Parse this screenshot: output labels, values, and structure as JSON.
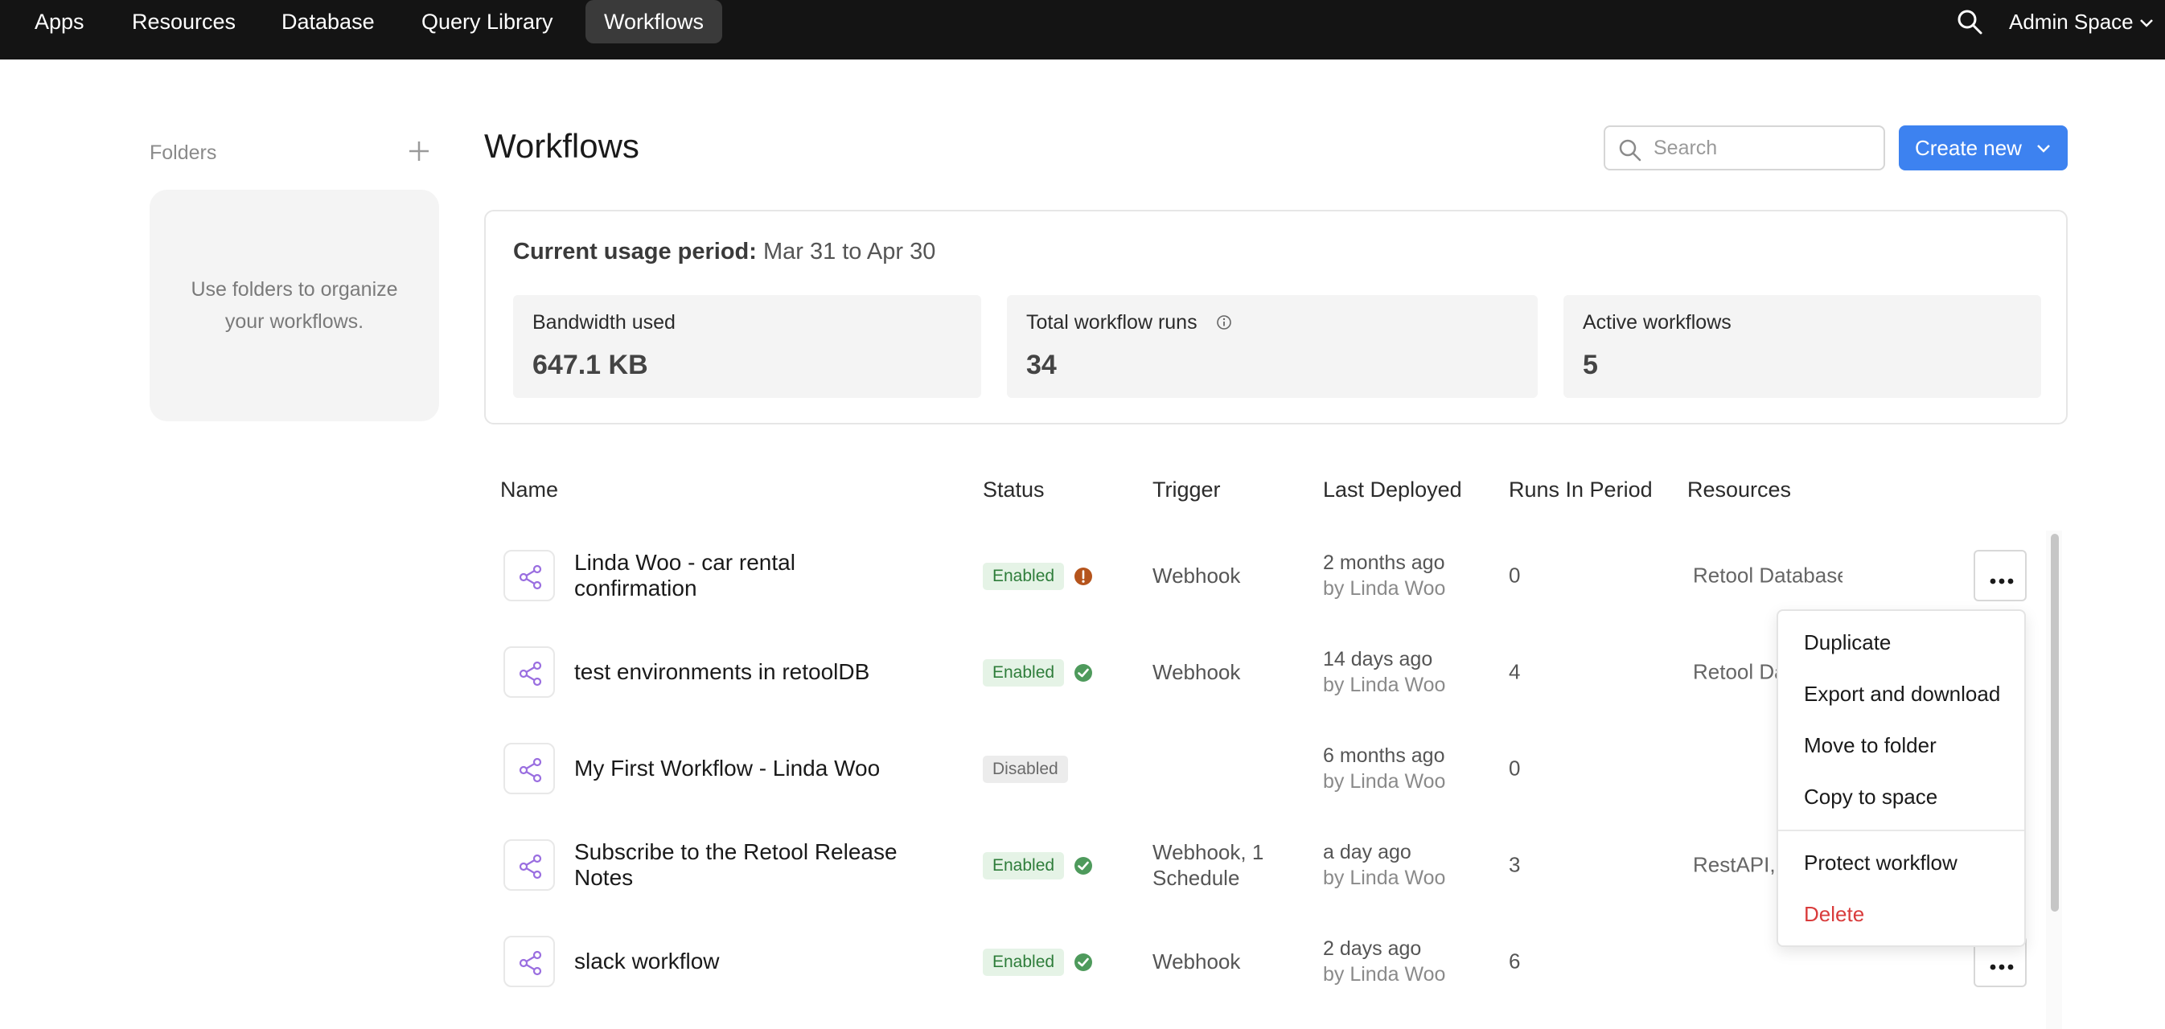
{
  "topnav": {
    "items": [
      {
        "label": "Apps"
      },
      {
        "label": "Resources"
      },
      {
        "label": "Database"
      },
      {
        "label": "Query Library"
      },
      {
        "label": "Workflows",
        "active": true
      }
    ],
    "space_label": "Admin Space",
    "search_icon": "search-icon"
  },
  "folders": {
    "label": "Folders",
    "empty_text": "Use folders to organize your workflows."
  },
  "header": {
    "title": "Workflows",
    "search_placeholder": "Search",
    "create_label": "Create new"
  },
  "usage": {
    "title": "Current usage period:",
    "period": "Mar 31 to Apr 30",
    "metrics": [
      {
        "label": "Bandwidth used",
        "value": "647.1 KB"
      },
      {
        "label": "Total workflow runs",
        "value": "34",
        "info_icon": true
      },
      {
        "label": "Active workflows",
        "value": "5"
      }
    ]
  },
  "table": {
    "columns": [
      "Name",
      "Status",
      "Trigger",
      "Last Deployed",
      "Runs In Period",
      "Resources"
    ],
    "rows": [
      {
        "name": "Linda Woo - car rental confirmation",
        "status": "Enabled",
        "status_icon": "warning",
        "trigger": "Webhook",
        "deployed": "2 months ago",
        "by": "by Linda Woo",
        "runs": "0",
        "resources": "Retool Database"
      },
      {
        "name": "test environments in retoolDB",
        "status": "Enabled",
        "status_icon": "check",
        "trigger": "Webhook",
        "deployed": "14 days ago",
        "by": "by Linda Woo",
        "runs": "4",
        "resources": "Retool Database"
      },
      {
        "name": "My First Workflow - Linda Woo",
        "status": "Disabled",
        "status_icon": "",
        "trigger": "",
        "deployed": "6 months ago",
        "by": "by Linda Woo",
        "runs": "0",
        "resources": ""
      },
      {
        "name": "Subscribe to the Retool Release Notes",
        "status": "Enabled",
        "status_icon": "check",
        "trigger": "Webhook, 1 Schedule",
        "deployed": "a day ago",
        "by": "by Linda Woo",
        "runs": "3",
        "resources": "RestAPI,"
      },
      {
        "name": "slack workflow",
        "status": "Enabled",
        "status_icon": "check",
        "trigger": "Webhook",
        "deployed": "2 days ago",
        "by": "by Linda Woo",
        "runs": "6",
        "resources": ""
      }
    ]
  },
  "context_menu": {
    "items": [
      "Duplicate",
      "Export and download",
      "Move to folder",
      "Copy to space",
      "Protect workflow",
      "Delete"
    ]
  },
  "colors": {
    "accent": "#3d82f0",
    "nav_bg": "#141414",
    "enabled_bg": "#e5f3e6",
    "enabled_text": "#2e7d3a",
    "warning": "#b5541c",
    "check": "#4e9a5c",
    "danger": "#d93c3c",
    "workflow_icon": "#9a6ee0"
  }
}
